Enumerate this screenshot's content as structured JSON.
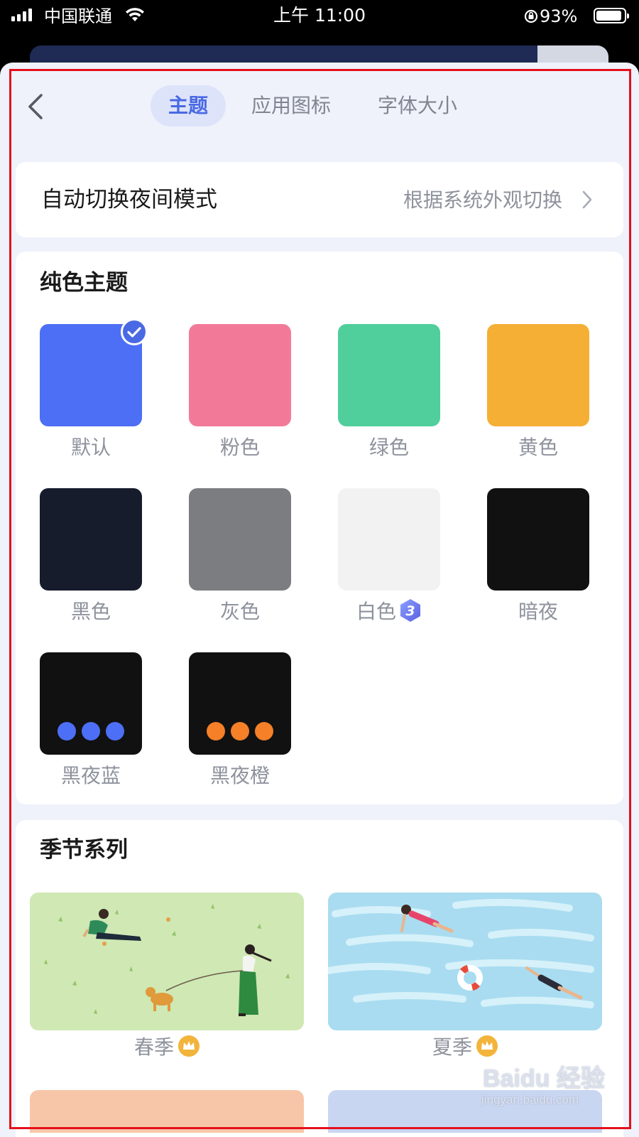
{
  "status_bar": {
    "carrier": "中国联通",
    "time": "上午 11:00",
    "battery_text": "93%",
    "battery_level": 0.93
  },
  "header": {
    "back_icon": "chevron-left-icon",
    "tabs": [
      {
        "label": "主题",
        "active": true
      },
      {
        "label": "应用图标",
        "active": false
      },
      {
        "label": "字体大小",
        "active": false
      }
    ]
  },
  "auto_night": {
    "label": "自动切换夜间模式",
    "value": "根据系统外观切换"
  },
  "solid_themes": {
    "title": "纯色主题",
    "items": [
      {
        "label": "默认",
        "color": "#4d6ff5",
        "selected": true
      },
      {
        "label": "粉色",
        "color": "#f27a98"
      },
      {
        "label": "绿色",
        "color": "#50cf9c"
      },
      {
        "label": "黄色",
        "color": "#f5af35"
      },
      {
        "label": "黑色",
        "color": "#171c2c"
      },
      {
        "label": "灰色",
        "color": "#7c7d80"
      },
      {
        "label": "白色",
        "color": "#f2f2f2",
        "badge": "3"
      },
      {
        "label": "暗夜",
        "color": "#111111"
      },
      {
        "label": "黑夜蓝",
        "color": "#111111",
        "dot_color": "#4d6ff5"
      },
      {
        "label": "黑夜橙",
        "color": "#111111",
        "dot_color": "#f58028"
      }
    ]
  },
  "season_series": {
    "title": "季节系列",
    "items": [
      {
        "label": "春季",
        "premium": true,
        "bg": "#cfe8b4"
      },
      {
        "label": "夏季",
        "premium": true,
        "bg": "#a9dcf0"
      }
    ]
  },
  "watermark": {
    "main": "Baidu 经验",
    "sub": "jingyan.baidu.com"
  }
}
